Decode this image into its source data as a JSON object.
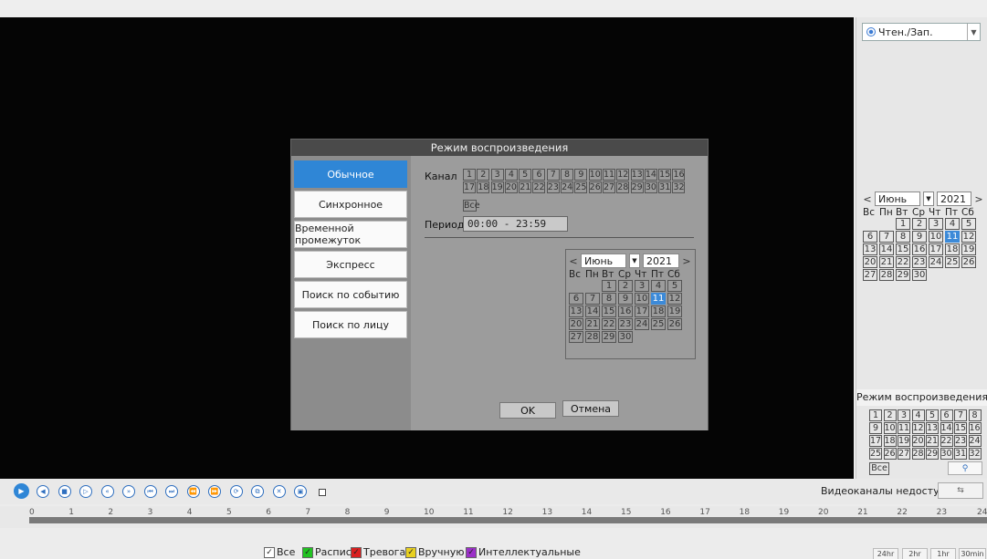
{
  "right_panel": {
    "mode_select": "Чтен./Зап.",
    "calendar": {
      "month": "Июнь",
      "year": "2021",
      "weekdays": [
        "Вс",
        "Пн",
        "Вт",
        "Ср",
        "Чт",
        "Пт",
        "Сб"
      ],
      "days": [
        "1",
        "2",
        "3",
        "4",
        "5",
        "6",
        "7",
        "8",
        "9",
        "10",
        "11",
        "12",
        "13",
        "14",
        "15",
        "16",
        "17",
        "18",
        "19",
        "20",
        "21",
        "22",
        "23",
        "24",
        "25",
        "26",
        "27",
        "28",
        "29",
        "30"
      ],
      "highlighted_day": "11"
    },
    "playback_mode_label": "Режим воспроизведения",
    "channels": [
      "1",
      "2",
      "3",
      "4",
      "5",
      "6",
      "7",
      "8",
      "9",
      "10",
      "11",
      "12",
      "13",
      "14",
      "15",
      "16",
      "17",
      "18",
      "19",
      "20",
      "21",
      "22",
      "23",
      "24",
      "25",
      "26",
      "27",
      "28",
      "29",
      "30",
      "31",
      "32"
    ],
    "all_label": "Все",
    "search_icon": "search-icon"
  },
  "dialog": {
    "title": "Режим воспроизведения",
    "menu": [
      "Обычное",
      "Синхронное",
      "Временной промежуток",
      "Экспресс",
      "Поиск по событию",
      "Поиск по лицу"
    ],
    "active_menu": "Обычное",
    "channel_label": "Канал",
    "channels": [
      "1",
      "2",
      "3",
      "4",
      "5",
      "6",
      "7",
      "8",
      "9",
      "10",
      "11",
      "12",
      "13",
      "14",
      "15",
      "16",
      "17",
      "18",
      "19",
      "20",
      "21",
      "22",
      "23",
      "24",
      "25",
      "26",
      "27",
      "28",
      "29",
      "30",
      "31",
      "32"
    ],
    "all_label": "Все",
    "period_label": "Период",
    "period_value": "00:00  -  23:59",
    "calendar": {
      "month": "Июнь",
      "year": "2021",
      "weekdays": [
        "Вс",
        "Пн",
        "Вт",
        "Ср",
        "Чт",
        "Пт",
        "Сб"
      ],
      "days": [
        "1",
        "2",
        "3",
        "4",
        "5",
        "6",
        "7",
        "8",
        "9",
        "10",
        "11",
        "12",
        "13",
        "14",
        "15",
        "16",
        "17",
        "18",
        "19",
        "20",
        "21",
        "22",
        "23",
        "24",
        "25",
        "26",
        "27",
        "28",
        "29",
        "30"
      ],
      "highlighted_day": "11"
    },
    "ok_label": "OK",
    "cancel_label": "Отмена"
  },
  "controls": {
    "status_text": "Видеоканалы недоступны",
    "buttons": [
      "play-icon",
      "rewind-icon",
      "stop-icon",
      "reverse-play-icon",
      "slow-icon",
      "fast-icon",
      "prev-frame-icon",
      "next-frame-icon",
      "prev-file-icon",
      "next-file-icon",
      "sync-icon",
      "copy-icon",
      "cut-icon",
      "backup-icon"
    ]
  },
  "timeline": {
    "ticks": [
      "0",
      "1",
      "2",
      "3",
      "4",
      "5",
      "6",
      "7",
      "8",
      "9",
      "10",
      "11",
      "12",
      "13",
      "14",
      "15",
      "16",
      "17",
      "18",
      "19",
      "20",
      "21",
      "22",
      "23",
      "24"
    ]
  },
  "legend": {
    "items": [
      {
        "label": "Все",
        "color": "#ffffff"
      },
      {
        "label": "Распис",
        "color": "#22c322"
      },
      {
        "label": "Тревога",
        "color": "#d92020"
      },
      {
        "label": "Вручную",
        "color": "#e8d020"
      },
      {
        "label": "Интеллектуальные",
        "color": "#9b30c8"
      }
    ],
    "zoom": [
      "24hr",
      "2hr",
      "1hr",
      "30min"
    ]
  }
}
